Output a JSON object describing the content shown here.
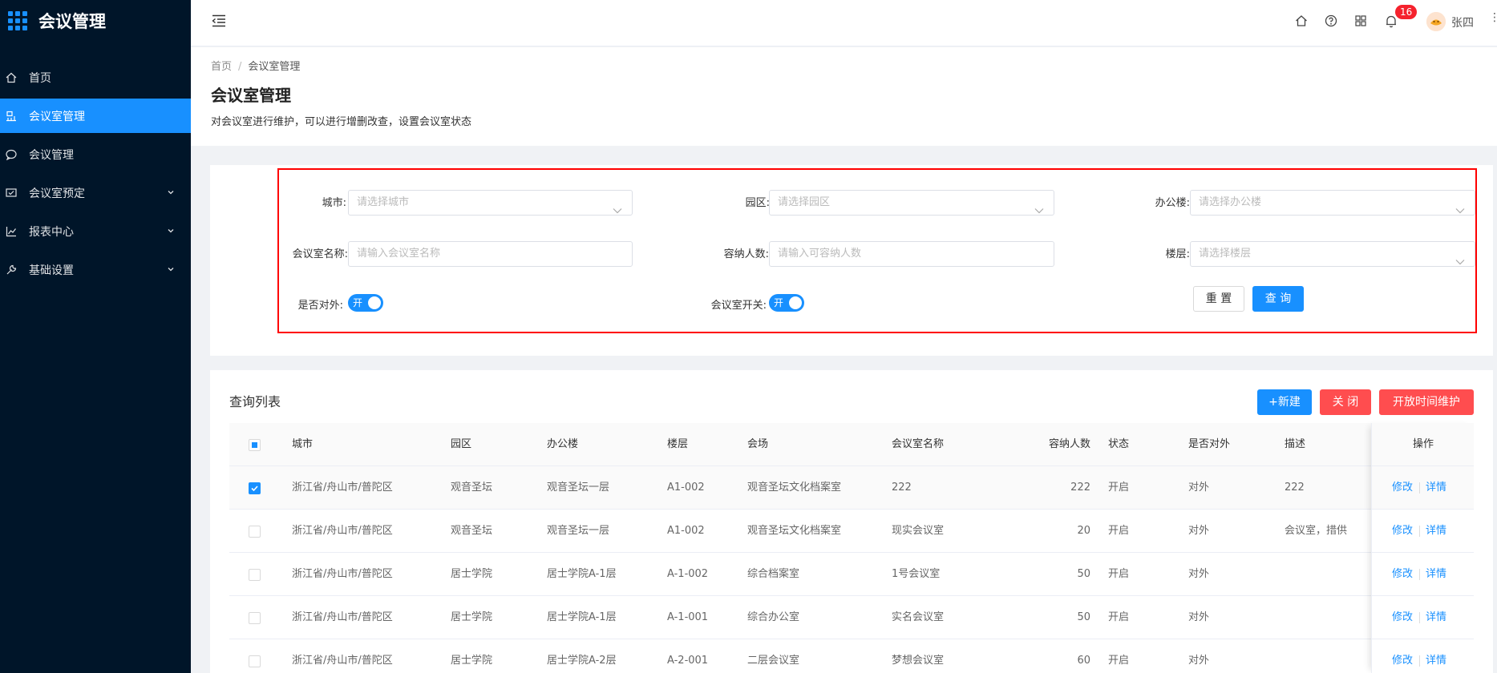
{
  "app": {
    "title": "会议管理"
  },
  "sidebar": {
    "items": [
      {
        "label": "首页",
        "icon": "home-icon"
      },
      {
        "label": "会议室管理",
        "icon": "meeting-room-icon",
        "active": true
      },
      {
        "label": "会议管理",
        "icon": "chat-icon"
      },
      {
        "label": "会议室预定",
        "icon": "booking-icon",
        "expandable": true
      },
      {
        "label": "报表中心",
        "icon": "chart-icon",
        "expandable": true
      },
      {
        "label": "基础设置",
        "icon": "wrench-icon",
        "expandable": true
      }
    ]
  },
  "header": {
    "notification_count": "16",
    "username": "张四"
  },
  "breadcrumb": {
    "home": "首页",
    "current": "会议室管理"
  },
  "page": {
    "title": "会议室管理",
    "description": "对会议室进行维护，可以进行增删改查，设置会议室状态"
  },
  "search": {
    "city_label": "城市:",
    "city_placeholder": "请选择城市",
    "park_label": "园区:",
    "park_placeholder": "请选择园区",
    "building_label": "办公楼:",
    "building_placeholder": "请选择办公楼",
    "room_name_label": "会议室名称:",
    "room_name_placeholder": "请输入会议室名称",
    "capacity_label": "容纳人数:",
    "capacity_placeholder": "请输入可容纳人数",
    "floor_label": "楼层:",
    "floor_placeholder": "请选择楼层",
    "external_label": "是否对外:",
    "external_switch": "开",
    "room_switch_label": "会议室开关:",
    "room_switch": "开",
    "reset_button": "重 置",
    "query_button": "查 询"
  },
  "list": {
    "title": "查询列表",
    "new_button": "+新建",
    "close_button": "关 闭",
    "open_time_button": "开放时间维护",
    "columns": [
      "城市",
      "园区",
      "办公楼",
      "楼层",
      "会场",
      "会议室名称",
      "容纳人数",
      "状态",
      "是否对外",
      "描述",
      "操作"
    ],
    "rows": [
      {
        "checked": true,
        "city": "浙江省/舟山市/普陀区",
        "park": "观音圣坛",
        "building": "观音圣坛一层",
        "floor": "A1-002",
        "venue": "观音圣坛文化档案室",
        "name": "222",
        "capacity": "222",
        "status": "开启",
        "external": "对外",
        "desc": "222"
      },
      {
        "checked": false,
        "city": "浙江省/舟山市/普陀区",
        "park": "观音圣坛",
        "building": "观音圣坛一层",
        "floor": "A1-002",
        "venue": "观音圣坛文化档案室",
        "name": "现实会议室",
        "capacity": "20",
        "status": "开启",
        "external": "对外",
        "desc": "会议室，措供"
      },
      {
        "checked": false,
        "city": "浙江省/舟山市/普陀区",
        "park": "居士学院",
        "building": "居士学院A-1层",
        "floor": "A-1-002",
        "venue": "综合档案室",
        "name": "1号会议室",
        "capacity": "50",
        "status": "开启",
        "external": "对外",
        "desc": ""
      },
      {
        "checked": false,
        "city": "浙江省/舟山市/普陀区",
        "park": "居士学院",
        "building": "居士学院A-1层",
        "floor": "A-1-001",
        "venue": "综合办公室",
        "name": "实名会议室",
        "capacity": "50",
        "status": "开启",
        "external": "对外",
        "desc": ""
      },
      {
        "checked": false,
        "city": "浙江省/舟山市/普陀区",
        "park": "居士学院",
        "building": "居士学院A-2层",
        "floor": "A-2-001",
        "venue": "二层会议室",
        "name": "梦想会议室",
        "capacity": "60",
        "status": "开启",
        "external": "对外",
        "desc": ""
      }
    ],
    "edit_label": "修改",
    "detail_label": "详情"
  },
  "colors": {
    "sidebar_bg": "#001529",
    "primary": "#1890ff",
    "danger": "#ff4d4f",
    "highlight_border": "#ff0000"
  }
}
